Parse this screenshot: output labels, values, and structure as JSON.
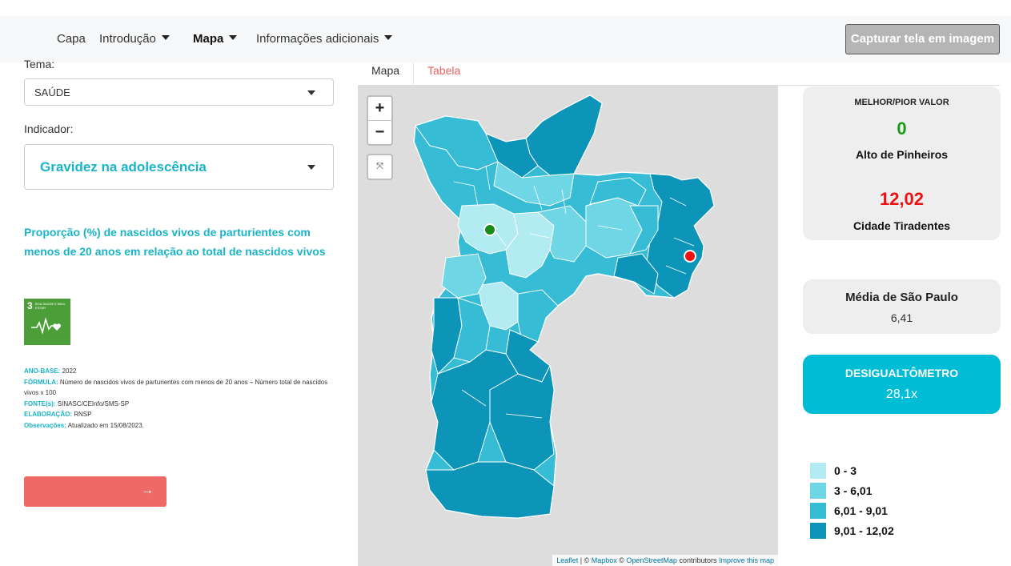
{
  "nav": {
    "items": [
      {
        "label": "Capa",
        "dropdown": false,
        "active": false
      },
      {
        "label": "Introdução",
        "dropdown": true,
        "active": false
      },
      {
        "label": "Mapa",
        "dropdown": true,
        "active": true
      },
      {
        "label": "Informações adicionais",
        "dropdown": true,
        "active": false
      }
    ],
    "capture_button": "Capturar tela em imagem"
  },
  "filters": {
    "theme_label": "Tema:",
    "theme_value": "SAÚDE",
    "indicator_label": "Indicador:",
    "indicator_value": "Gravidez na adolescência"
  },
  "description": "Proporção (%) de nascidos vivos de parturientes com menos de 20 anos em relação ao total de nascidos vivos",
  "sdg": {
    "number": "3",
    "text": "BOA SAÚDE E BEM-ESTAR",
    "color": "#4c9f38"
  },
  "metadata": {
    "ano_key": "ANO-BASE:",
    "ano_val": "2022",
    "formula_key": "FÓRMULA:",
    "formula_val": "Número de nascidos vivos de parturientes com menos de 20 anos ÷ Número total de nascidos vivos x 100",
    "fonte_key": "FONTE(s):",
    "fonte_val": "SINASC/CEInfo/SMS-SP",
    "elab_key": "ELABORAÇÃO:",
    "elab_val": "RNSP",
    "obs_key": "Observações:",
    "obs_val": "Atualizado em 15/08/2023."
  },
  "next_button": {
    "icon": "→"
  },
  "tabs": [
    {
      "label": "Mapa",
      "active": true
    },
    {
      "label": "Tabela",
      "active": false
    }
  ],
  "map": {
    "zoom_in": "+",
    "zoom_out": "−",
    "fullscreen": "⤧",
    "attribution": {
      "leaflet": "Leaflet",
      "sep1": " | © ",
      "mapbox": "Mapbox",
      "sep2": " © ",
      "osm": "OpenStreetMap",
      "contrib": " contributors ",
      "improve": "Improve this map"
    }
  },
  "best_worst": {
    "title": "MELHOR/PIOR VALOR",
    "best_value": "0",
    "best_place": "Alto de Pinheiros",
    "worst_value": "12,02",
    "worst_place": "Cidade Tiradentes",
    "best_color": "#169c16",
    "worst_color": "#ee1111"
  },
  "average": {
    "title": "Média de São Paulo",
    "value": "6,41"
  },
  "desigualtometro": {
    "title": "DESIGUALTÔMETRO",
    "value": "28,1x",
    "color": "#00bcd4"
  },
  "legend": [
    {
      "label": "0 - 3",
      "color": "#b2ebf2"
    },
    {
      "label": "3 - 6,01",
      "color": "#6fd6e6"
    },
    {
      "label": "6,01 - 9,01",
      "color": "#37bcd6"
    },
    {
      "label": "9,01 - 12,02",
      "color": "#0c95b8"
    }
  ]
}
